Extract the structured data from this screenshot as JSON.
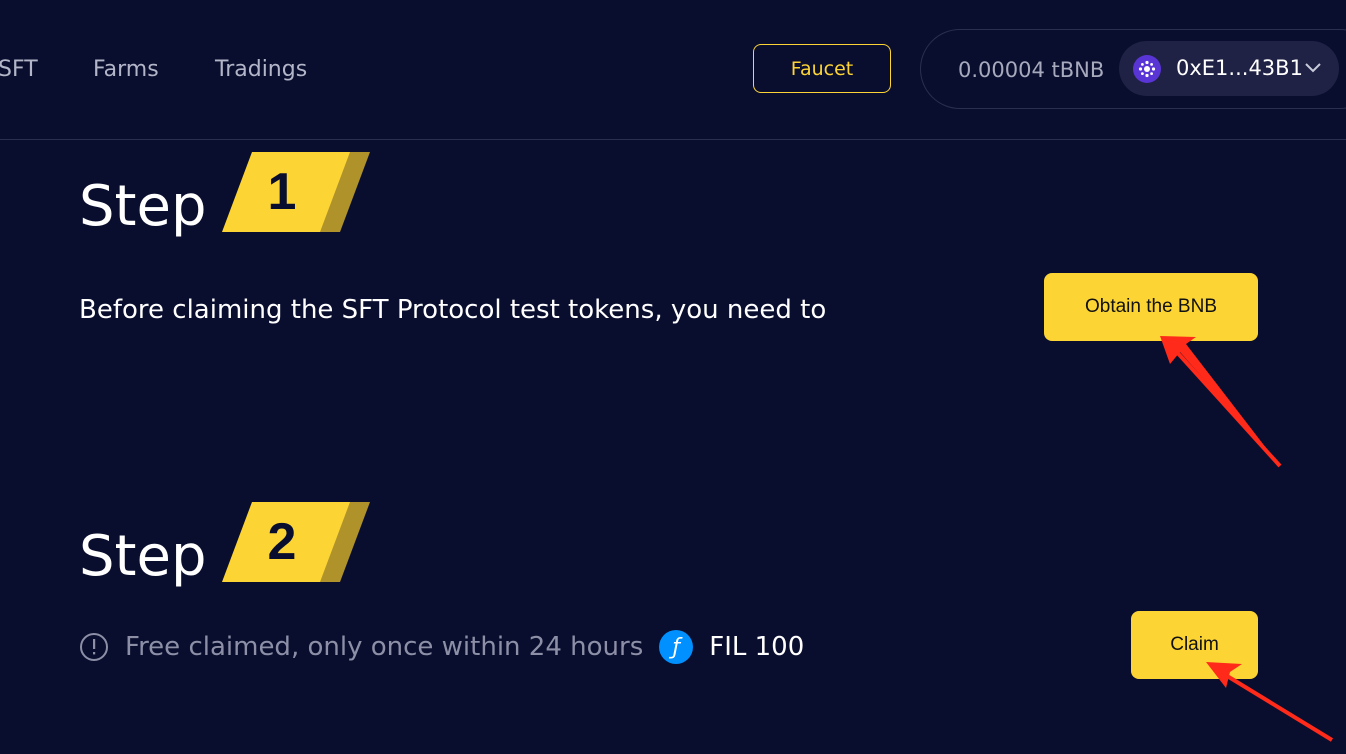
{
  "nav": {
    "items": [
      {
        "label": "SFT"
      },
      {
        "label": "Farms"
      },
      {
        "label": "Tradings"
      }
    ],
    "faucet_label": "Faucet"
  },
  "wallet": {
    "balance": "0.00004 tBNB",
    "address": "0xE1...43B1",
    "avatar_icon": "network-logo-icon",
    "chevron_icon": "chevron-down-icon"
  },
  "step1": {
    "word": "Step",
    "number": "1",
    "description": "Before claiming the SFT Protocol test tokens, you need to",
    "button_label": "Obtain the BNB"
  },
  "step2": {
    "word": "Step",
    "number": "2",
    "notice": "Free claimed, only once within 24 hours",
    "token_icon": "filecoin-icon",
    "token_amount": "FIL 100",
    "button_label": "Claim"
  },
  "colors": {
    "background": "#0a0e2e",
    "accent": "#fcd535",
    "annotation_arrow": "#ff2a1a"
  }
}
